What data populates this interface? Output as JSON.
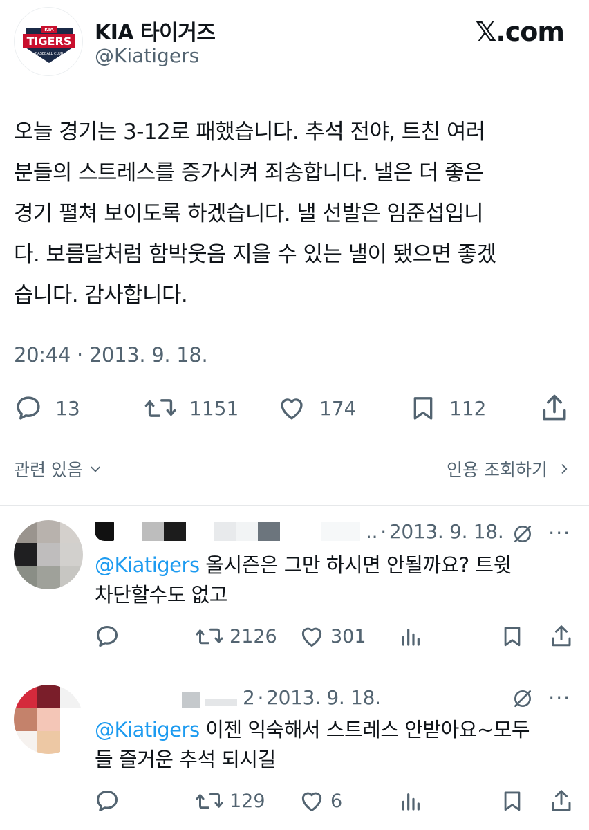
{
  "author": {
    "name": "KIA 타이거즈",
    "handle": "@Kiatigers",
    "logo_text": "TIGERS",
    "logo_top": "KIA",
    "logo_sub": "BASEBALL CLUB"
  },
  "brand": "𝕏.com",
  "tweet": {
    "text": "오늘 경기는 3-12로 패했습니다. 추석 전야, 트친 여러\n분들의 스트레스를 증가시켜 죄송합니다. 낼은 더 좋은\n경기 펼쳐 보이도록 하겠습니다. 낼 선발은 임준섭입니\n다. 보름달처럼 함박웃음 지을 수 있는 낼이 됐으면 좋겠\n습니다. 감사합니다.",
    "timestamp": "20:44 · 2013. 9. 18.",
    "replies": "13",
    "retweets": "1151",
    "likes": "174",
    "bookmarks": "112"
  },
  "related_label": "관련 있음",
  "view_quotes_label": "인용 조회하기",
  "colors": {
    "accent": "#1d9bf0",
    "muted": "#536471",
    "text": "#0f1419",
    "brand_red": "#c8102e",
    "brand_navy": "#1b2a47"
  },
  "replies": [
    {
      "date_prefix": "..",
      "date": "2013. 9. 18.",
      "mention": "@Kiatigers",
      "text": " 올시즌은 그만 하시면 안될까요? 트윗\n차단할수도 없고",
      "retweets": "2126",
      "likes": "301",
      "avatar_colors": [
        "#9a948e",
        "#b8b2ad",
        "#d4d0cc",
        "#1f1f21",
        "#bfbdbd",
        "#d2d0cd",
        "#8a8e86",
        "#9fa19a",
        "#c7c6c2"
      ]
    },
    {
      "date_prefix": "2",
      "date": "2013. 9. 18.",
      "mention": "@Kiatigers",
      "text": " 이젠 익숙해서 스트레스 안받아요~모두\n들 즐거운 추석 되시길",
      "retweets": "129",
      "likes": "6",
      "avatar_colors": [
        "#d42a3c",
        "#7a1e2a",
        "#f2f2f2",
        "#c4826b",
        "#f4c6b7",
        "#ffffff",
        "#f6f2ef",
        "#edc8a4",
        "#ffffff"
      ]
    }
  ],
  "icons": {
    "reply": "reply-bubble-icon",
    "retweet": "retweet-icon",
    "like": "heart-icon",
    "bookmark": "bookmark-icon",
    "share": "share-icon",
    "views": "views-chart-icon",
    "grok": "grok-icon",
    "more": "more-dots-icon",
    "chevron_down": "chevron-down-icon",
    "chevron_right": "chevron-right-icon"
  }
}
